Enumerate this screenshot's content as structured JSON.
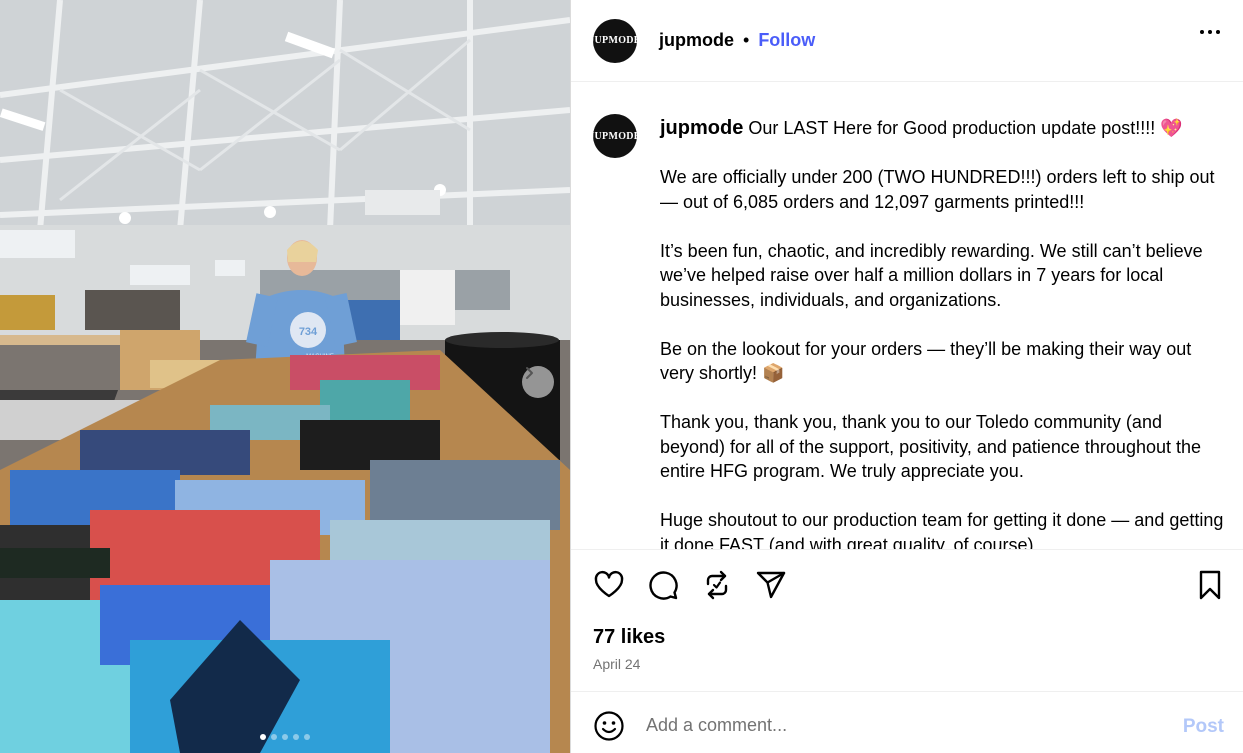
{
  "post": {
    "username": "jupmode",
    "avatar_text": "JUPMODE",
    "follow_label": "Follow",
    "separator": "•",
    "more_icon": "more-horizontal-icon"
  },
  "photo": {
    "shirt_text_1": "734",
    "shirt_text_2": "MACHINE",
    "slide_count": 5,
    "active_slide": 1,
    "next_icon": "chevron-right-icon"
  },
  "caption": {
    "username": "jupmode",
    "lead": "Our LAST Here for Good production update post!!!! 💖",
    "paragraphs": [
      "We are officially under 200 (TWO HUNDRED!!!) orders left to ship out — out of 6,085 orders and 12,097 garments printed!!!",
      "It’s been fun, chaotic, and incredibly rewarding. We still can’t believe we’ve helped raise over half a million dollars in 7 years for local businesses, individuals, and organizations.",
      "Be on the lookout for your orders — they’ll be making their way out very shortly! 📦",
      "Thank you, thank you, thank you to our Toledo community (and beyond) for all of the support, positivity, and patience throughout the entire HFG program. We truly appreciate you.",
      "Huge shoutout to our production team for getting it done — and getting it done FAST (and with great quality, of course)."
    ]
  },
  "actions": {
    "icons": [
      "heart-icon",
      "comment-icon",
      "repost-icon",
      "share-icon",
      "bookmark-icon"
    ],
    "likes": "77 likes",
    "date": "April 24"
  },
  "comment": {
    "placeholder": "Add a comment...",
    "post_label": "Post",
    "emoji_icon": "emoji-icon"
  },
  "colors": {
    "follow": "#4a5df9",
    "post_disabled": "#b3c8f9",
    "muted": "#737373",
    "heart_emoji": "#e8457a"
  }
}
